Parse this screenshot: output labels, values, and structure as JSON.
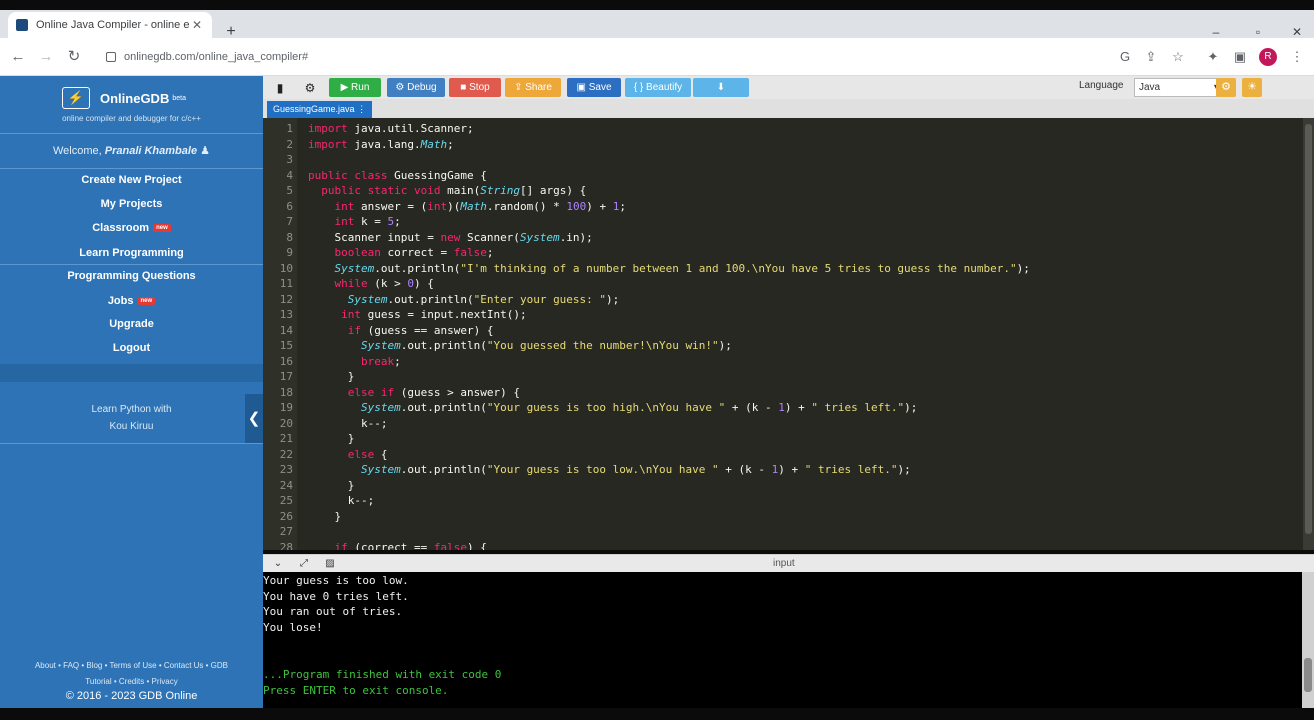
{
  "browser": {
    "tab_title": "Online Java Compiler - online e",
    "url": "onlinegdb.com/online_java_compiler#",
    "avatar_letter": "R"
  },
  "sidebar": {
    "logo_text": "OnlineGDB",
    "logo_badge": "beta",
    "tagline": "online compiler and debugger for c/c++",
    "welcome_prefix": "Welcome, ",
    "user_name": "Pranali Khambale",
    "menu": [
      {
        "label": "Create New Project"
      },
      {
        "label": "My Projects"
      },
      {
        "label": "Classroom",
        "badge": "new"
      },
      {
        "label": "Learn Programming"
      },
      {
        "label": "Programming Questions"
      },
      {
        "label": "Jobs",
        "badge": "new"
      },
      {
        "label": "Upgrade"
      },
      {
        "label": "Logout"
      }
    ],
    "promo_line1": "Learn Python with",
    "promo_line2": "Kou Kiruu",
    "footer_line1": "About • FAQ • Blog • Terms of Use • Contact Us • GDB",
    "footer_line2": "Tutorial • Credits • Privacy",
    "copyright": "© 2016 - 2023 GDB Online"
  },
  "toolbar": {
    "run": "Run",
    "debug": "Debug",
    "stop": "Stop",
    "share": "Share",
    "save": "Save",
    "beautify": "{ } Beautify",
    "language_label": "Language",
    "language_value": "Java",
    "colors": {
      "run": "#2fae46",
      "debug": "#3f7fc2",
      "stop": "#e05a4e",
      "share": "#eea83a",
      "save": "#2c6fc2",
      "beautify": "#5cb4e8",
      "download": "#5cb4e8"
    }
  },
  "file_tab": "GuessingGame.java",
  "code_lines": [
    {
      "n": "1",
      "text": "import java.util.Scanner;"
    },
    {
      "n": "2",
      "text": "import java.lang.Math;"
    },
    {
      "n": "3",
      "text": ""
    },
    {
      "n": "4",
      "text": "public class GuessingGame {"
    },
    {
      "n": "5",
      "text": "  public static void main(String[] args) {"
    },
    {
      "n": "6",
      "text": "    int answer = (int)(Math.random() * 100) + 1;"
    },
    {
      "n": "7",
      "text": "    int k = 5;"
    },
    {
      "n": "8",
      "text": "    Scanner input = new Scanner(System.in);"
    },
    {
      "n": "9",
      "text": "    boolean correct = false;"
    },
    {
      "n": "10",
      "text": "    System.out.println(\"I'm thinking of a number between 1 and 100.\\nYou have 5 tries to guess the number.\");"
    },
    {
      "n": "11",
      "text": "    while (k > 0) {"
    },
    {
      "n": "12",
      "text": "      System.out.println(\"Enter your guess: \");"
    },
    {
      "n": "13",
      "text": "     int guess = input.nextInt();"
    },
    {
      "n": "14",
      "text": "      if (guess == answer) {"
    },
    {
      "n": "15",
      "text": "        System.out.println(\"You guessed the number!\\nYou win!\");"
    },
    {
      "n": "16",
      "text": "        break;"
    },
    {
      "n": "17",
      "text": "      }"
    },
    {
      "n": "18",
      "text": "      else if (guess > answer) {"
    },
    {
      "n": "19",
      "text": "        System.out.println(\"Your guess is too high.\\nYou have \" + (k - 1) + \" tries left.\");"
    },
    {
      "n": "20",
      "text": "        k--;"
    },
    {
      "n": "21",
      "text": "      }"
    },
    {
      "n": "22",
      "text": "      else {"
    },
    {
      "n": "23",
      "text": "        System.out.println(\"Your guess is too low.\\nYou have \" + (k - 1) + \" tries left.\");"
    },
    {
      "n": "24",
      "text": "      }"
    },
    {
      "n": "25",
      "text": "      k--;"
    },
    {
      "n": "26",
      "text": "    }"
    },
    {
      "n": "27",
      "text": ""
    },
    {
      "n": "28",
      "text": "    if (correct == false) {"
    }
  ],
  "console": {
    "bar_label": "input",
    "lines": [
      "Your guess is too low.",
      "You have 0 tries left.",
      "You ran out of tries.",
      "You lose!",
      "",
      "",
      "...Program finished with exit code 0",
      "Press ENTER to exit console."
    ]
  }
}
